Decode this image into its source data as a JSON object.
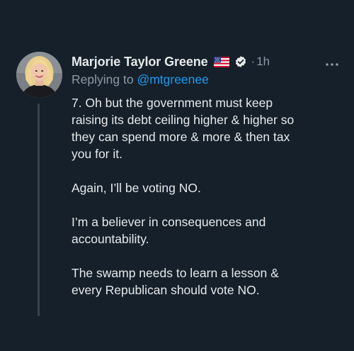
{
  "tweet": {
    "author_name": "Marjorie Taylor Greene",
    "flag_icon": "us-flag-icon",
    "verified_icon": "verified-badge-icon",
    "separator": "·",
    "time": "1h",
    "more_icon": "more-dots-icon",
    "reply_prefix": "Replying to",
    "reply_handle": "@mtgreenee",
    "paragraphs": [
      "7. Oh but the government must keep\nraising its debt ceiling higher & higher so\nthey can spend more & more & then tax\nyou for it.",
      "Again, I’ll be voting NO.",
      "I’m a believer in consequences and\naccountability.",
      "The swamp needs to learn a lesson &\nevery Republican should vote NO."
    ]
  },
  "colors": {
    "background": "#15202b",
    "primary_text": "#e7e9ea",
    "secondary_text": "#8b98a5",
    "link": "#1d9bf0",
    "thread_line": "#38444d"
  }
}
